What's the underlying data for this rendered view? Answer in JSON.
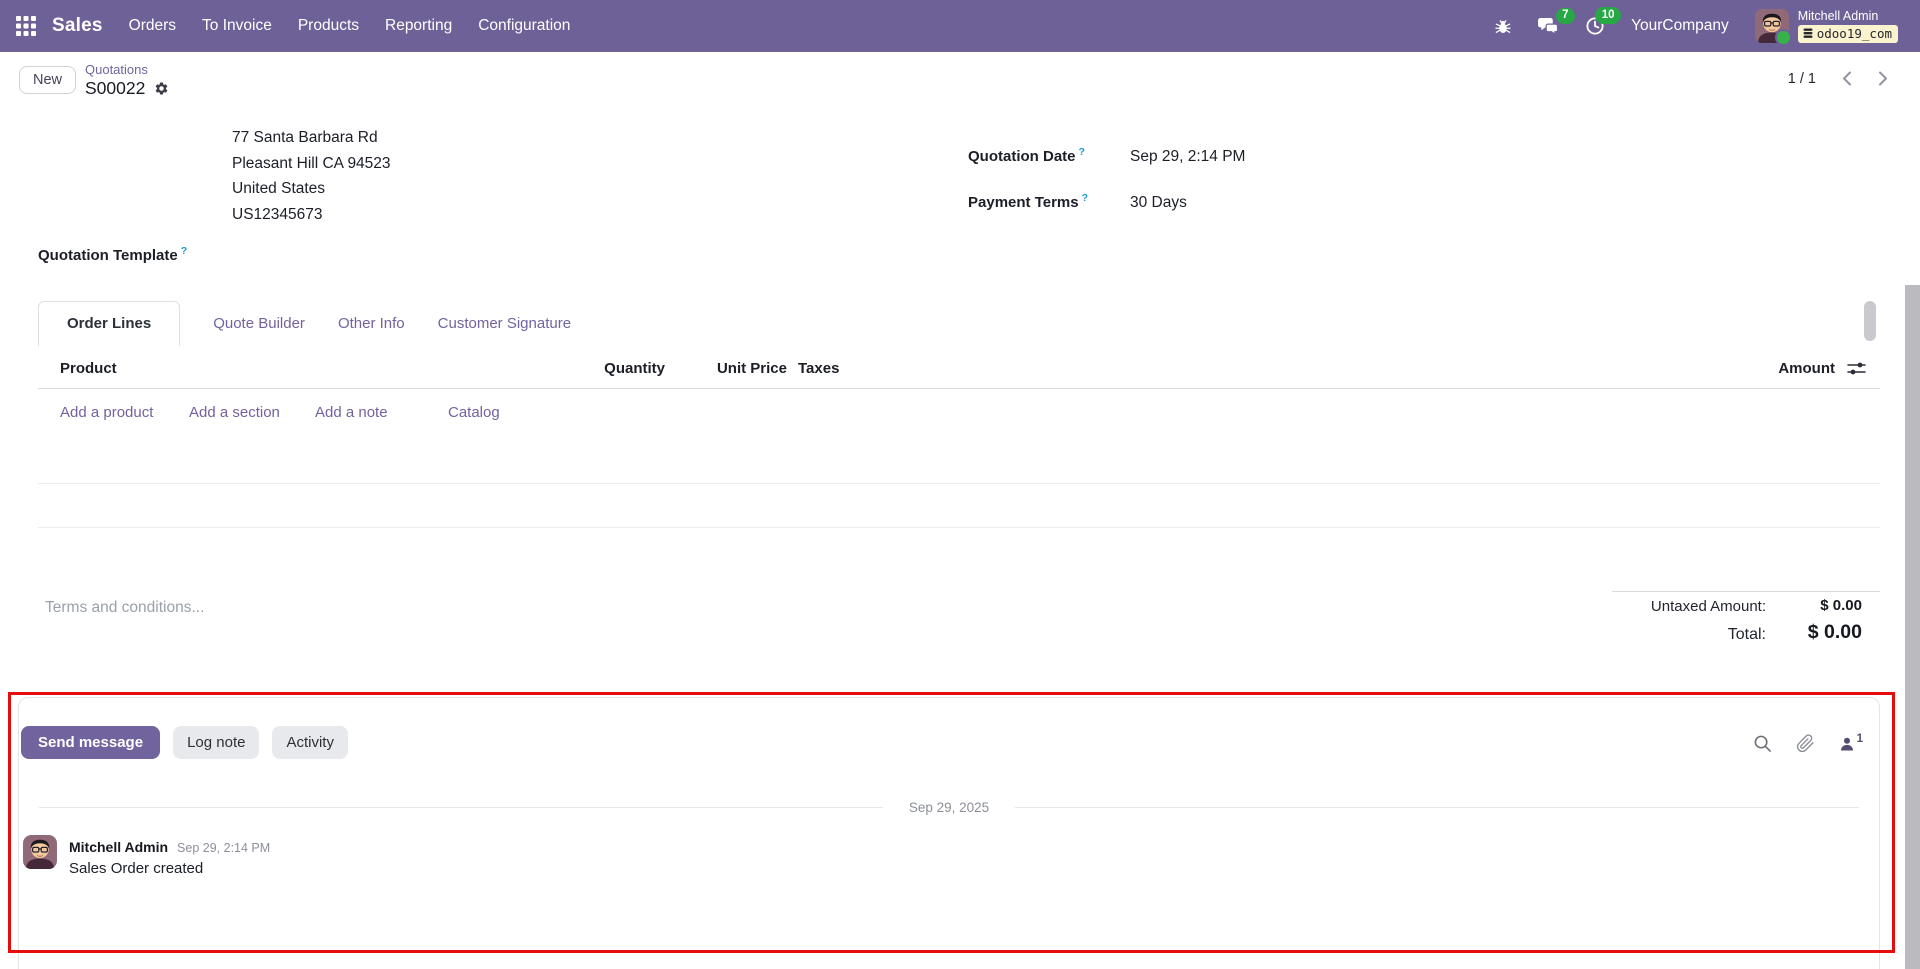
{
  "topbar": {
    "app_name": "Sales",
    "menus": [
      "Orders",
      "To Invoice",
      "Products",
      "Reporting",
      "Configuration"
    ],
    "message_badge": "7",
    "activity_badge": "10",
    "company": "YourCompany",
    "user_name": "Mitchell Admin",
    "database": "odoo19_com"
  },
  "control_panel": {
    "new_button": "New",
    "breadcrumb_parent": "Quotations",
    "record_name": "S00022",
    "pager": "1 / 1"
  },
  "form": {
    "address_lines": [
      "77 Santa Barbara Rd",
      "Pleasant Hill CA 94523",
      "United States",
      "US12345673"
    ],
    "fields": {
      "quotation_date_label": "Quotation Date",
      "quotation_date_value": "Sep 29, 2:14 PM",
      "payment_terms_label": "Payment Terms",
      "payment_terms_value": "30 Days",
      "quotation_template_label": "Quotation Template",
      "help_marker": "?"
    },
    "tabs": [
      "Order Lines",
      "Quote Builder",
      "Other Info",
      "Customer Signature"
    ],
    "order_lines": {
      "columns": [
        "Product",
        "Quantity",
        "Unit Price",
        "Taxes",
        "Amount"
      ],
      "actions": [
        "Add a product",
        "Add a section",
        "Add a note",
        "Catalog"
      ]
    },
    "terms_placeholder": "Terms and conditions...",
    "totals": {
      "untaxed_label": "Untaxed Amount:",
      "untaxed_value": "$ 0.00",
      "total_label": "Total:",
      "total_value": "$ 0.00"
    }
  },
  "chatter": {
    "buttons": [
      "Send message",
      "Log note",
      "Activity"
    ],
    "followers_count": "1",
    "date_divider": "Sep 29, 2025",
    "message": {
      "author": "Mitchell Admin",
      "timestamp": "Sep 29, 2:14 PM",
      "body": "Sales Order created"
    }
  },
  "colors": {
    "topbar_purple": "#6e6198",
    "accent_purple": "#71639e",
    "badge_green": "#28a745",
    "database_badge_bg": "#fbf3cd",
    "annotation_red": "#e80b0b"
  }
}
